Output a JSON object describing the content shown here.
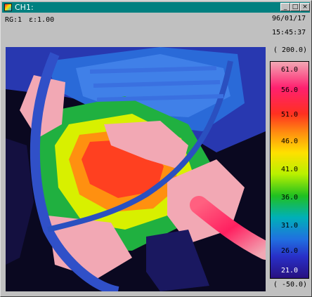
{
  "window": {
    "title": "CH1:"
  },
  "controls": {
    "minimize": "_",
    "maximize": "□",
    "close": "×"
  },
  "header": {
    "range": "RG:1",
    "emissivity": "ε:1.00",
    "date": "96/01/17",
    "time": "15:45:37"
  },
  "scale": {
    "top_value": "( 200.0)",
    "bottom_value": "( -50.0)",
    "ticks": [
      "61.0",
      "56.0",
      "51.0",
      "46.0",
      "41.0",
      "36.0",
      "31.0",
      "26.0",
      "21.0"
    ]
  },
  "colors": {
    "titlebar": "#008080",
    "hot": "#f2a8b4",
    "cold": "#281080"
  }
}
